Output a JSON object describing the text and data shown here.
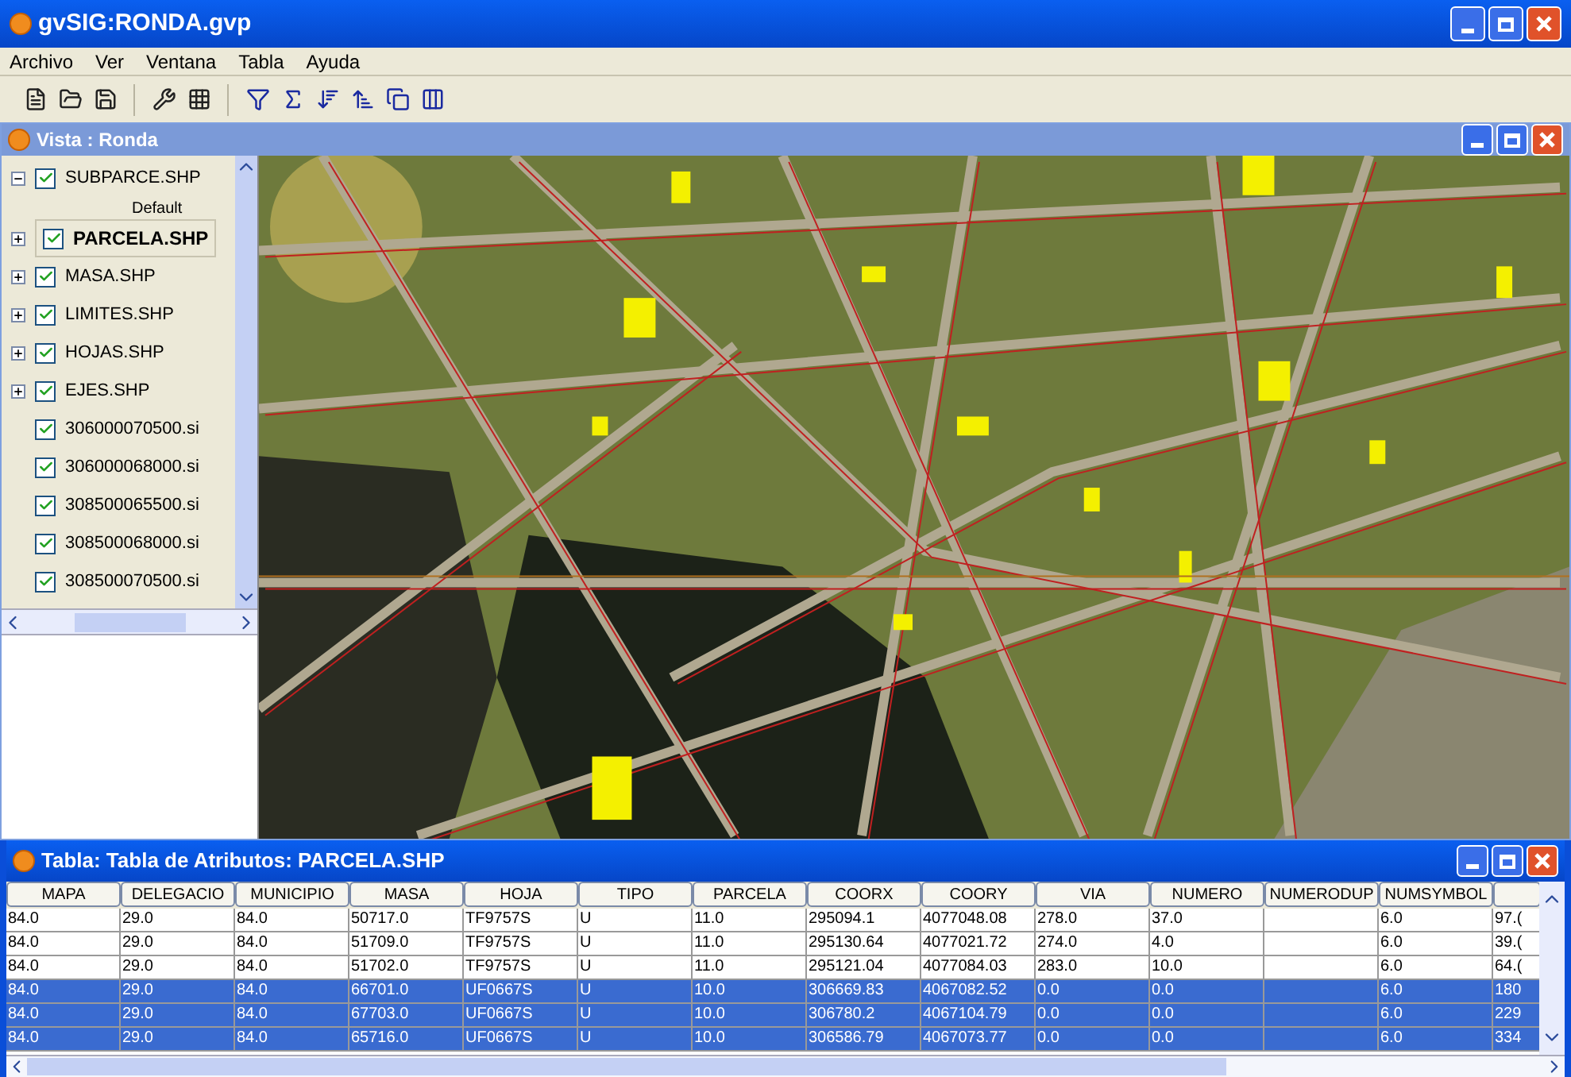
{
  "window": {
    "title": "gvSIG:RONDA.gvp"
  },
  "menu": [
    "Archivo",
    "Ver",
    "Ventana",
    "Tabla",
    "Ayuda"
  ],
  "view": {
    "title": "Vista : Ronda",
    "layers": [
      {
        "name": "SUBPARCE.SHP",
        "kind": "vector",
        "checked": true,
        "expanded": true,
        "selected": false,
        "legend": "Default"
      },
      {
        "name": "PARCELA.SHP",
        "kind": "vector",
        "checked": true,
        "expanded": false,
        "selected": true
      },
      {
        "name": "MASA.SHP",
        "kind": "vector",
        "checked": true,
        "expanded": false,
        "selected": false
      },
      {
        "name": "LIMITES.SHP",
        "kind": "vector",
        "checked": true,
        "expanded": false,
        "selected": false
      },
      {
        "name": "HOJAS.SHP",
        "kind": "vector",
        "checked": true,
        "expanded": false,
        "selected": false
      },
      {
        "name": "EJES.SHP",
        "kind": "vector",
        "checked": true,
        "expanded": false,
        "selected": false
      },
      {
        "name": "306000070500.si",
        "kind": "raster",
        "checked": true,
        "selected": false
      },
      {
        "name": "306000068000.si",
        "kind": "raster",
        "checked": true,
        "selected": false
      },
      {
        "name": "308500065500.si",
        "kind": "raster",
        "checked": true,
        "selected": false
      },
      {
        "name": "308500068000.si",
        "kind": "raster",
        "checked": true,
        "selected": false
      },
      {
        "name": "308500070500.si",
        "kind": "raster",
        "checked": true,
        "selected": false
      }
    ]
  },
  "table": {
    "title": "Tabla: Tabla de Atributos: PARCELA.SHP",
    "columns": [
      "MAPA",
      "DELEGACIO",
      "MUNICIPIO",
      "MASA",
      "HOJA",
      "TIPO",
      "PARCELA",
      "COORX",
      "COORY",
      "VIA",
      "NUMERO",
      "NUMERODUP",
      "NUMSYMBOL"
    ],
    "rows": [
      {
        "selected": false,
        "cells": [
          "84.0",
          "29.0",
          "84.0",
          "50717.0",
          "TF9757S",
          "U",
          "11.0",
          "295094.1",
          "4077048.08",
          "278.0",
          "37.0",
          null,
          "6.0",
          "97.("
        ]
      },
      {
        "selected": false,
        "cells": [
          "84.0",
          "29.0",
          "84.0",
          "51709.0",
          "TF9757S",
          "U",
          "11.0",
          "295130.64",
          "4077021.72",
          "274.0",
          "4.0",
          null,
          "6.0",
          "39.("
        ]
      },
      {
        "selected": false,
        "cells": [
          "84.0",
          "29.0",
          "84.0",
          "51702.0",
          "TF9757S",
          "U",
          "11.0",
          "295121.04",
          "4077084.03",
          "283.0",
          "10.0",
          null,
          "6.0",
          "64.("
        ]
      },
      {
        "selected": true,
        "cells": [
          "84.0",
          "29.0",
          "84.0",
          "66701.0",
          "UF0667S",
          "U",
          "10.0",
          "306669.83",
          "4067082.52",
          "0.0",
          "0.0",
          null,
          "6.0",
          "180"
        ]
      },
      {
        "selected": true,
        "cells": [
          "84.0",
          "29.0",
          "84.0",
          "67703.0",
          "UF0667S",
          "U",
          "10.0",
          "306780.2",
          "4067104.79",
          "0.0",
          "0.0",
          null,
          "6.0",
          "229"
        ]
      },
      {
        "selected": true,
        "cells": [
          "84.0",
          "29.0",
          "84.0",
          "65716.0",
          "UF0667S",
          "U",
          "10.0",
          "306586.79",
          "4067073.77",
          "0.0",
          "0.0",
          null,
          "6.0",
          "334"
        ]
      }
    ]
  }
}
